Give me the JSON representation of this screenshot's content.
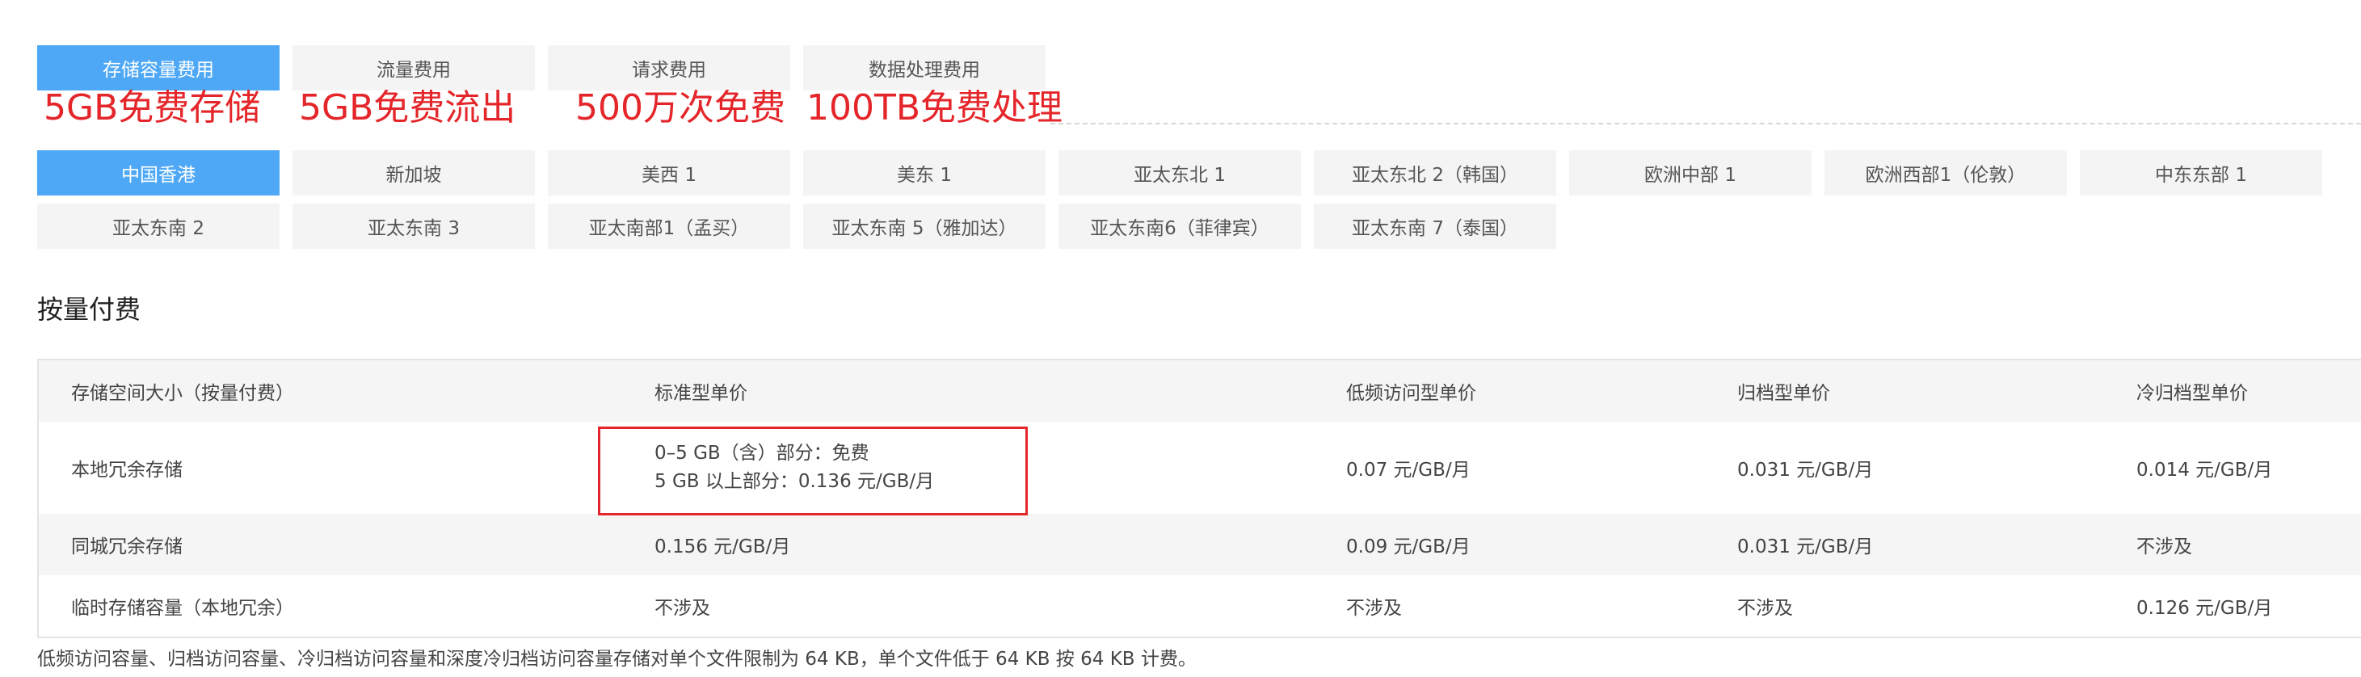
{
  "fee_tabs": [
    {
      "label": "存储容量费用",
      "active": true
    },
    {
      "label": "流量费用",
      "active": false
    },
    {
      "label": "请求费用",
      "active": false
    },
    {
      "label": "数据处理费用",
      "active": false
    }
  ],
  "free_notes": [
    "5GB免费存储",
    "5GB免费流出",
    "500万次免费",
    "100TB免费处理"
  ],
  "region_tabs": [
    {
      "label": "中国香港",
      "active": true
    },
    {
      "label": "新加坡",
      "active": false
    },
    {
      "label": "美西 1",
      "active": false
    },
    {
      "label": "美东 1",
      "active": false
    },
    {
      "label": "亚太东北 1",
      "active": false
    },
    {
      "label": "亚太东北 2（韩国）",
      "active": false
    },
    {
      "label": "欧洲中部 1",
      "active": false
    },
    {
      "label": "欧洲西部1（伦敦）",
      "active": false
    },
    {
      "label": "中东东部 1",
      "active": false
    },
    {
      "label": "亚太东南 2",
      "active": false
    },
    {
      "label": "亚太东南 3",
      "active": false
    },
    {
      "label": "亚太南部1（孟买）",
      "active": false
    },
    {
      "label": "亚太东南 5（雅加达）",
      "active": false
    },
    {
      "label": "亚太东南6（菲律宾）",
      "active": false
    },
    {
      "label": "亚太东南 7（泰国）",
      "active": false
    }
  ],
  "section_title": "按量付费",
  "pricing_table": {
    "headers": [
      "存储空间大小（按量付费）",
      "标准型单价",
      "低频访问型单价",
      "归档型单价",
      "冷归档型单价"
    ],
    "rows": [
      {
        "name": "本地冗余存储",
        "standard": [
          "0–5 GB（含）部分：免费",
          "5 GB 以上部分：0.136 元/GB/月"
        ],
        "infrequent": "0.07 元/GB/月",
        "archive": "0.031 元/GB/月",
        "cold_archive": "0.014 元/GB/月"
      },
      {
        "name": "同城冗余存储",
        "standard": "0.156 元/GB/月",
        "infrequent": "0.09 元/GB/月",
        "archive": "0.031 元/GB/月",
        "cold_archive": "不涉及"
      },
      {
        "name": "临时存储容量（本地冗余）",
        "standard": "不涉及",
        "infrequent": "不涉及",
        "archive": "不涉及",
        "cold_archive": "0.126 元/GB/月"
      }
    ]
  },
  "footnote": "低频访问容量、归档访问容量、冷归档访问容量和深度冷归档访问容量存储对单个文件限制为 64 KB，单个文件低于 64 KB 按 64 KB 计费。",
  "colors": {
    "active_tab": "#4ea8f5",
    "inactive_tab": "#f4f4f4",
    "annotation_red": "#e4262a"
  }
}
